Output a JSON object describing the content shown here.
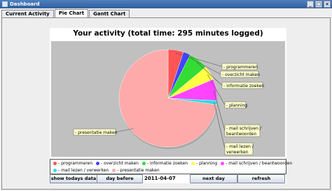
{
  "window": {
    "title": "Dashboard"
  },
  "tabs": [
    {
      "label": "Current Activity",
      "active": false
    },
    {
      "label": "Pie Chart",
      "active": true
    },
    {
      "label": "Gantt Chart",
      "active": false
    }
  ],
  "chart_data": {
    "type": "pie",
    "title": "Your activity (total time: 295 minutes logged)",
    "total_minutes": 295,
    "slices": [
      {
        "label": "programmeren",
        "color": "#ff5555",
        "value": 15
      },
      {
        "label": "overzicht maken",
        "color": "#4444ff",
        "value": 7
      },
      {
        "label": "informatie zoeken",
        "color": "#33dd33",
        "value": 19
      },
      {
        "label": "planning",
        "color": "#ffff44",
        "value": 14
      },
      {
        "label": "mail schrijven / beantwoorden",
        "color": "#ff44ff",
        "value": 21
      },
      {
        "label": "mail lezen / verwerken",
        "color": "#33dddd",
        "value": 4
      },
      {
        "label": "presentatie maken",
        "color": "#ffaaaa",
        "value": 215
      }
    ],
    "callouts": [
      [
        "programmeren"
      ],
      [
        "overzicht maken"
      ],
      [
        "informatie zoeken"
      ],
      [
        "planning"
      ],
      [
        "mail schrijven /",
        "beantwoorden"
      ],
      [
        "mail lezen /",
        "verwerken"
      ],
      [
        "presentatie maken"
      ]
    ],
    "legend": [
      "programmeren",
      "overzicht maken",
      "informatie zoeken",
      "planning",
      "mail schrijven / beantwoorden",
      "mail lezen / verwerken",
      "presentatie maken"
    ]
  },
  "controls": {
    "show_today": "show todays data",
    "day_before": "day before",
    "date": "2011-04-07",
    "next_day": "next day",
    "refresh": "refresh"
  }
}
